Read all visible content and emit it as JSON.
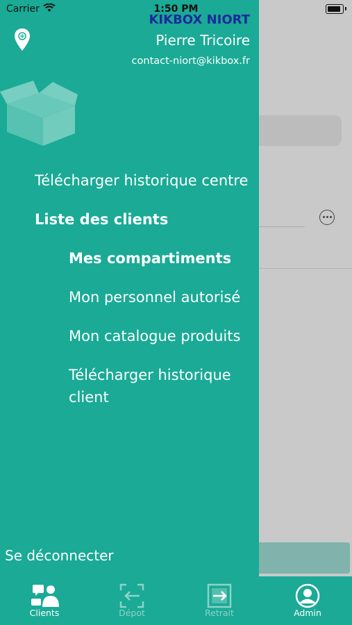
{
  "status_bar": {
    "carrier": "Carrier",
    "time": "1:50 PM"
  },
  "drawer": {
    "brand": "KIKBOX NIORT",
    "user_name": "Pierre Tricoire",
    "email": "contact-niort@kikbox.fr",
    "menu": [
      {
        "label": "Télécharger historique centre",
        "bold": false
      },
      {
        "label": "Liste des clients",
        "bold": true
      },
      {
        "label": "Mes compartiments",
        "bold": true
      },
      {
        "label": "Mon personnel autorisé",
        "bold": false
      },
      {
        "label": "Mon catalogue produits",
        "bold": false
      },
      {
        "label": "Télécharger historique client",
        "bold": false
      }
    ],
    "logout": "Se déconnecter"
  },
  "tabs": [
    {
      "label": "Clients",
      "icon": "clients-icon",
      "active": true
    },
    {
      "label": "Dépot",
      "icon": "deposit-icon",
      "active": false
    },
    {
      "label": "Retrait",
      "icon": "withdraw-icon",
      "active": false
    },
    {
      "label": "Admin",
      "icon": "admin-icon",
      "active": true
    }
  ],
  "colors": {
    "drawer": "#1aaa96",
    "brand": "#1c2a9c",
    "inactive_tab": "#8ed3c8"
  }
}
